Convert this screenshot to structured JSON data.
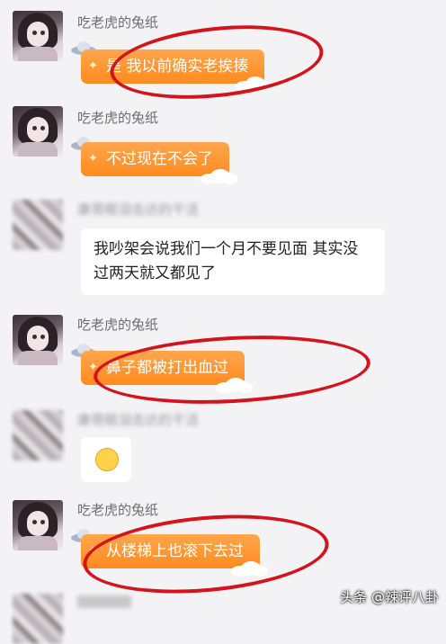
{
  "contact_name": "吃老虎的兔纸",
  "messages": [
    {
      "sender": "吃老虎的兔纸",
      "text": "是  我以前确实老挨揍"
    },
    {
      "sender": "吃老虎的兔纸",
      "text": "不过现在不会了"
    },
    {
      "sender": "康哥眼泪击达的干活",
      "text": "我吵架会说我们一个月不要见面 其实没过两天就又都见了"
    },
    {
      "sender": "吃老虎的兔纸",
      "text": "鼻子都被打出血过"
    },
    {
      "sender": "康哥眼泪击达的干活",
      "text": ""
    },
    {
      "sender": "吃老虎的兔纸",
      "text": "从楼梯上也滚下去过"
    }
  ],
  "watermark": "头条 @辣评八卦",
  "colors": {
    "bubble_orange": "#ff9a30",
    "annotation_red": "#d4141c"
  }
}
